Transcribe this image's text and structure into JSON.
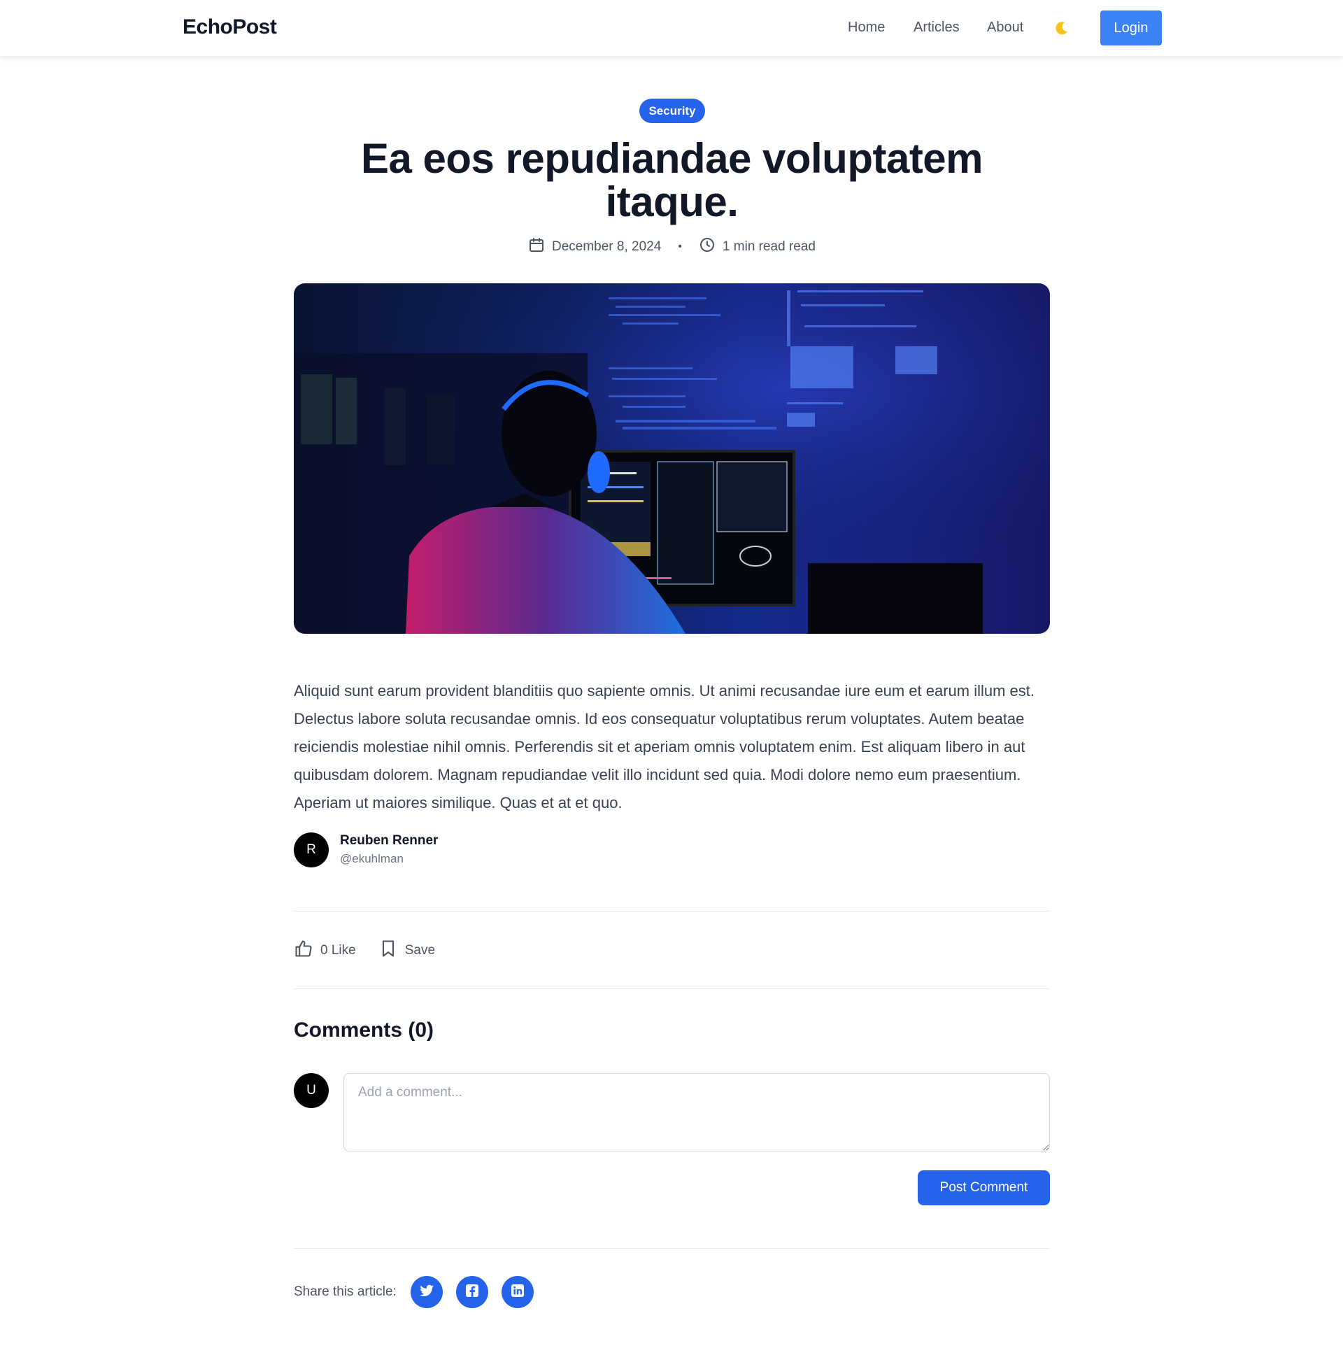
{
  "header": {
    "logo": "EchoPost",
    "nav": [
      "Home",
      "Articles",
      "About"
    ],
    "theme_icon": "moon-icon",
    "login_label": "Login"
  },
  "article": {
    "category": "Security",
    "title": "Ea eos repudiandae voluptatem itaque.",
    "date": "December 8, 2024",
    "separator": "•",
    "read_time": "1 min read read",
    "body": "Aliquid sunt earum provident blanditiis quo sapiente omnis. Ut animi recusandae iure eum et earum illum est. Delectus labore soluta recusandae omnis. Id eos consequatur voluptatibus rerum voluptates. Autem beatae reiciendis molestiae nihil omnis. Perferendis sit et aperiam omnis voluptatem enim. Est aliquam libero in aut quibusdam dolorem. Magnam repudiandae velit illo incidunt sed quia. Modi dolore nemo eum praesentium. Aperiam ut maiores similique. Quas et at et quo."
  },
  "author": {
    "initial": "R",
    "name": "Reuben Renner",
    "handle": "@ekuhlman"
  },
  "actions": {
    "like_label": "0 Like",
    "save_label": "Save"
  },
  "comments": {
    "title": "Comments (0)",
    "user_initial": "U",
    "placeholder": "Add a comment...",
    "post_label": "Post Comment"
  },
  "share": {
    "label": "Share this article:",
    "icons": [
      "twitter-icon",
      "facebook-icon",
      "linkedin-icon"
    ]
  },
  "colors": {
    "primary": "#2563eb",
    "login": "#3b82f6",
    "text": "#111827",
    "muted": "#4b5563",
    "moon": "#f5c518"
  }
}
